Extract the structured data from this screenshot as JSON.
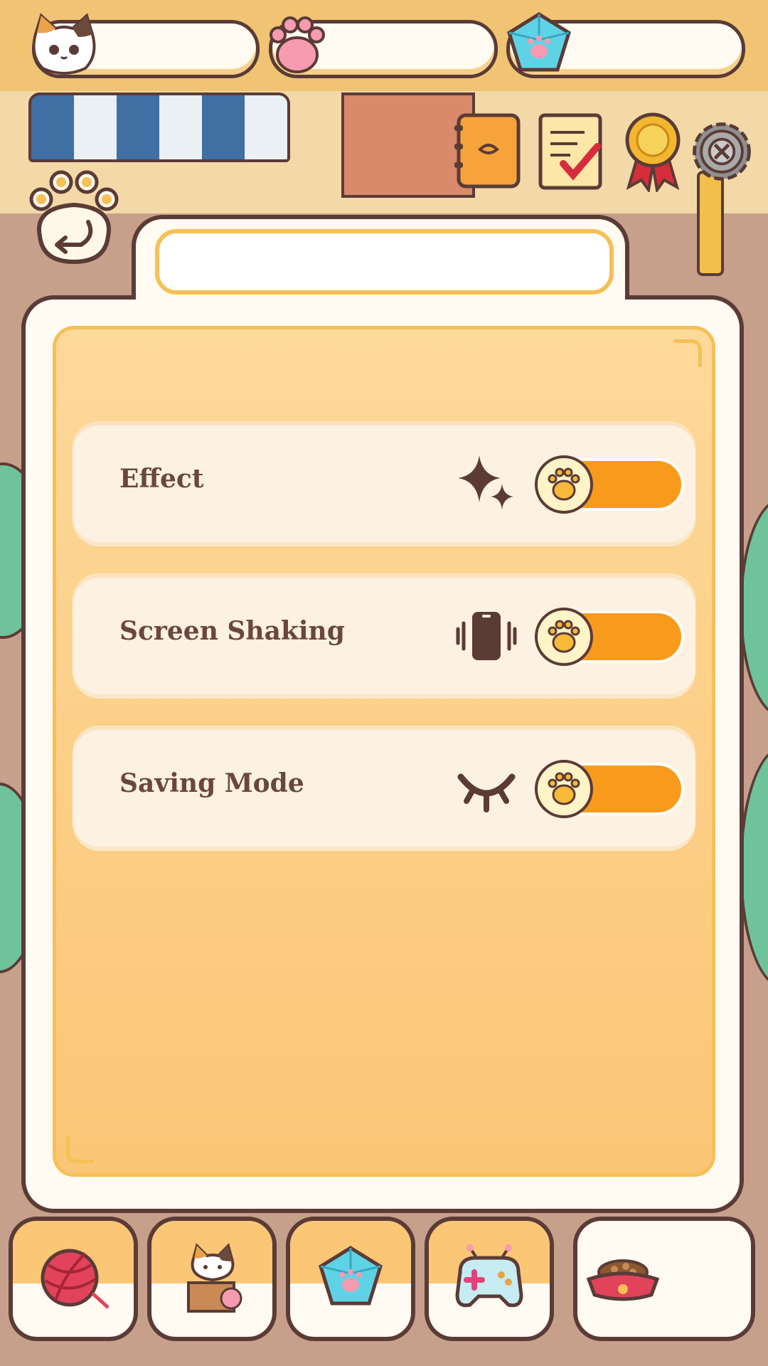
{
  "currencies": [
    {
      "icon": "calico-cat-icon",
      "value": ""
    },
    {
      "icon": "paw-print-icon",
      "value": ""
    },
    {
      "icon": "paw-gem-icon",
      "value": ""
    }
  ],
  "top_menu": [
    "notebook-icon",
    "checklist-icon",
    "medal-icon",
    "settings-gear-icon"
  ],
  "back_button": {
    "icon": "paw-back-icon"
  },
  "panel": {
    "title": ""
  },
  "settings": {
    "rows": [
      {
        "label": "Effect",
        "icon": "sparkles-icon",
        "enabled": true
      },
      {
        "label": "Screen Shaking",
        "icon": "phone-vibrate-icon",
        "enabled": true
      },
      {
        "label": "Saving Mode",
        "icon": "closed-eye-icon",
        "enabled": true
      }
    ]
  },
  "bottom_nav": [
    "yarn-ball-icon",
    "cat-in-box-icon",
    "paw-gem-icon",
    "game-controller-icon",
    "food-bowl-icon"
  ],
  "colors": {
    "outline": "#5b3b36",
    "panel_bg": "#fbc676",
    "toggle_on": "#f89a1c",
    "row_bg": "#fdf1e1",
    "topbar": "#f0c26e"
  }
}
